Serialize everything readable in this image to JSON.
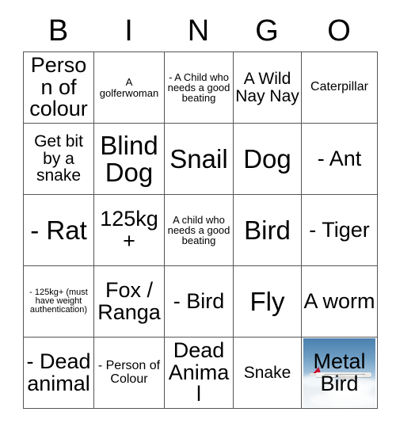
{
  "card": {
    "header_letters": [
      "B",
      "I",
      "N",
      "G",
      "O"
    ],
    "rows": [
      [
        {
          "text": "Person of colour",
          "size": "s-lg"
        },
        {
          "text": "A golferwoman",
          "size": "s-xs"
        },
        {
          "text": "- A Child who needs a good beating",
          "size": "s-xs"
        },
        {
          "text": "A Wild Nay Nay",
          "size": "s-md"
        },
        {
          "text": "Caterpillar",
          "size": "s-sm"
        }
      ],
      [
        {
          "text": "Get bit by a snake",
          "size": "s-md"
        },
        {
          "text": "Blind Dog",
          "size": "s-xl"
        },
        {
          "text": "Snail",
          "size": "s-xl"
        },
        {
          "text": "Dog",
          "size": "s-xl"
        },
        {
          "text": "- Ant",
          "size": "s-lg"
        }
      ],
      [
        {
          "text": "- Rat",
          "size": "s-xl"
        },
        {
          "text": "125kg+",
          "size": "s-lg"
        },
        {
          "text": "A child who needs a good beating",
          "size": "s-xs"
        },
        {
          "text": "Bird",
          "size": "s-xl"
        },
        {
          "text": "- Tiger",
          "size": "s-lg"
        }
      ],
      [
        {
          "text": "- 125kg+ (must have weight authentication)",
          "size": "s-xxs"
        },
        {
          "text": "Fox / Ranga",
          "size": "s-lg"
        },
        {
          "text": "- Bird",
          "size": "s-lg"
        },
        {
          "text": "Fly",
          "size": "s-xl"
        },
        {
          "text": "A worm",
          "size": "s-lg"
        }
      ],
      [
        {
          "text": "- Dead animal",
          "size": "s-lg"
        },
        {
          "text": "- Person of Colour",
          "size": "s-sm"
        },
        {
          "text": "Dead Animal",
          "size": "s-lg"
        },
        {
          "text": "Snake",
          "size": "s-md"
        },
        {
          "text": "Metal Bird",
          "size": "s-lg",
          "image": "airplane-photo"
        }
      ]
    ]
  },
  "colors": {
    "grid_line": "#555555",
    "text": "#000000",
    "background": "#ffffff",
    "tail_red": "#c8102e",
    "sky_blue": "#4a7fae"
  }
}
